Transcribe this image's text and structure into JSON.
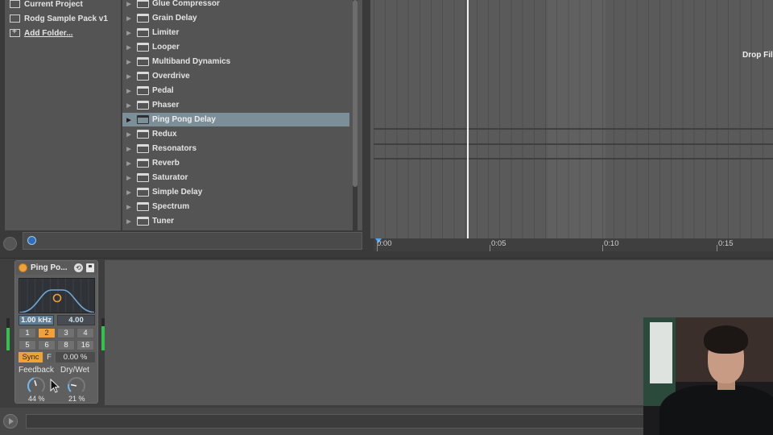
{
  "browser": {
    "places": [
      {
        "label": "Current Project",
        "icon": "project-icon"
      },
      {
        "label": "Rodg Sample Pack v1",
        "icon": "folder-icon"
      },
      {
        "label": "Add Folder...",
        "icon": "add-folder-icon"
      }
    ],
    "items": [
      {
        "label": "Glue Compressor"
      },
      {
        "label": "Grain Delay"
      },
      {
        "label": "Limiter"
      },
      {
        "label": "Looper"
      },
      {
        "label": "Multiband Dynamics"
      },
      {
        "label": "Overdrive"
      },
      {
        "label": "Pedal"
      },
      {
        "label": "Phaser"
      },
      {
        "label": "Ping Pong Delay",
        "selected": true
      },
      {
        "label": "Redux"
      },
      {
        "label": "Resonators"
      },
      {
        "label": "Reverb"
      },
      {
        "label": "Saturator"
      },
      {
        "label": "Simple Delay"
      },
      {
        "label": "Spectrum"
      },
      {
        "label": "Tuner"
      }
    ],
    "selected_color": "#7c8e98"
  },
  "arrangement": {
    "drop_text": "Drop File",
    "ruler": [
      "0:00",
      "0:05",
      "0:10",
      "0:15"
    ]
  },
  "device": {
    "title": "Ping Po...",
    "on_color": "#f0a23a",
    "freq_value": "1.00",
    "freq_unit": "kHz",
    "width_value": "4.00",
    "beat_rows": [
      [
        "1",
        "2",
        "3",
        "4"
      ],
      [
        "5",
        "6",
        "8",
        "16"
      ]
    ],
    "beat_selected": "2",
    "sync_label": "Sync",
    "f_label": "F",
    "offset_value": "0.00 %",
    "feedback_label": "Feedback",
    "feedback_value": "44 %",
    "feedback_level": 0.44,
    "drywet_label": "Dry/Wet",
    "drywet_value": "21 %",
    "drywet_level": 0.21,
    "accent_color": "#f0a23a"
  }
}
